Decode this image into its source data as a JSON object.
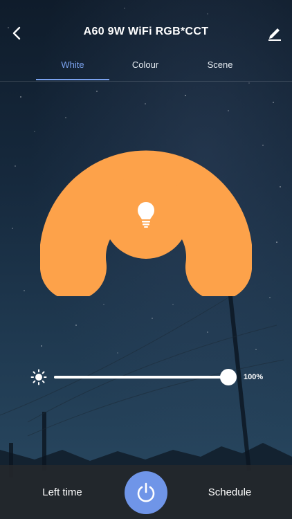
{
  "header": {
    "title": "A60 9W WiFi  RGB*CCT",
    "back_icon": "chevron-left-icon",
    "edit_icon": "pencil-icon"
  },
  "tabs": [
    {
      "label": "White",
      "active": true
    },
    {
      "label": "Colour",
      "active": false
    },
    {
      "label": "Scene",
      "active": false
    }
  ],
  "dial": {
    "color": "#fda24a",
    "center_icon": "lightbulb-icon"
  },
  "brightness": {
    "icon": "sun-icon",
    "value": 100,
    "label": "100%"
  },
  "bottom_bar": {
    "left_label": "Left time",
    "right_label": "Schedule",
    "power_icon": "power-icon",
    "power_color": "#6f95e8"
  },
  "colors": {
    "accent": "#7aa2ee",
    "dial": "#fda24a"
  }
}
